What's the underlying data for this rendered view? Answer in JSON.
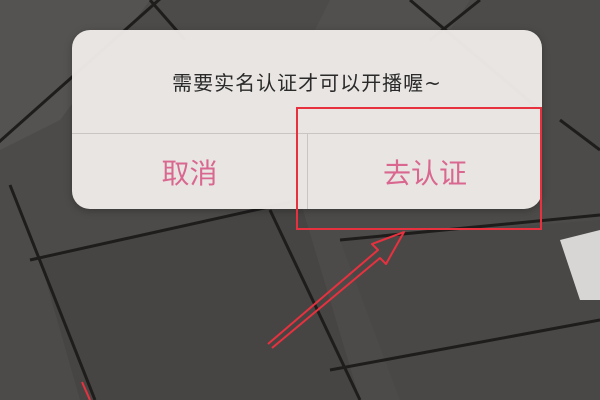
{
  "dialog": {
    "message": "需要实名认证才可以开播喔~",
    "cancel_label": "取消",
    "confirm_label": "去认证"
  },
  "colors": {
    "button_text": "#d9678f",
    "annotation": "#e8313f",
    "dialog_bg": "#eeebe9",
    "backdrop": "#4b4947"
  }
}
